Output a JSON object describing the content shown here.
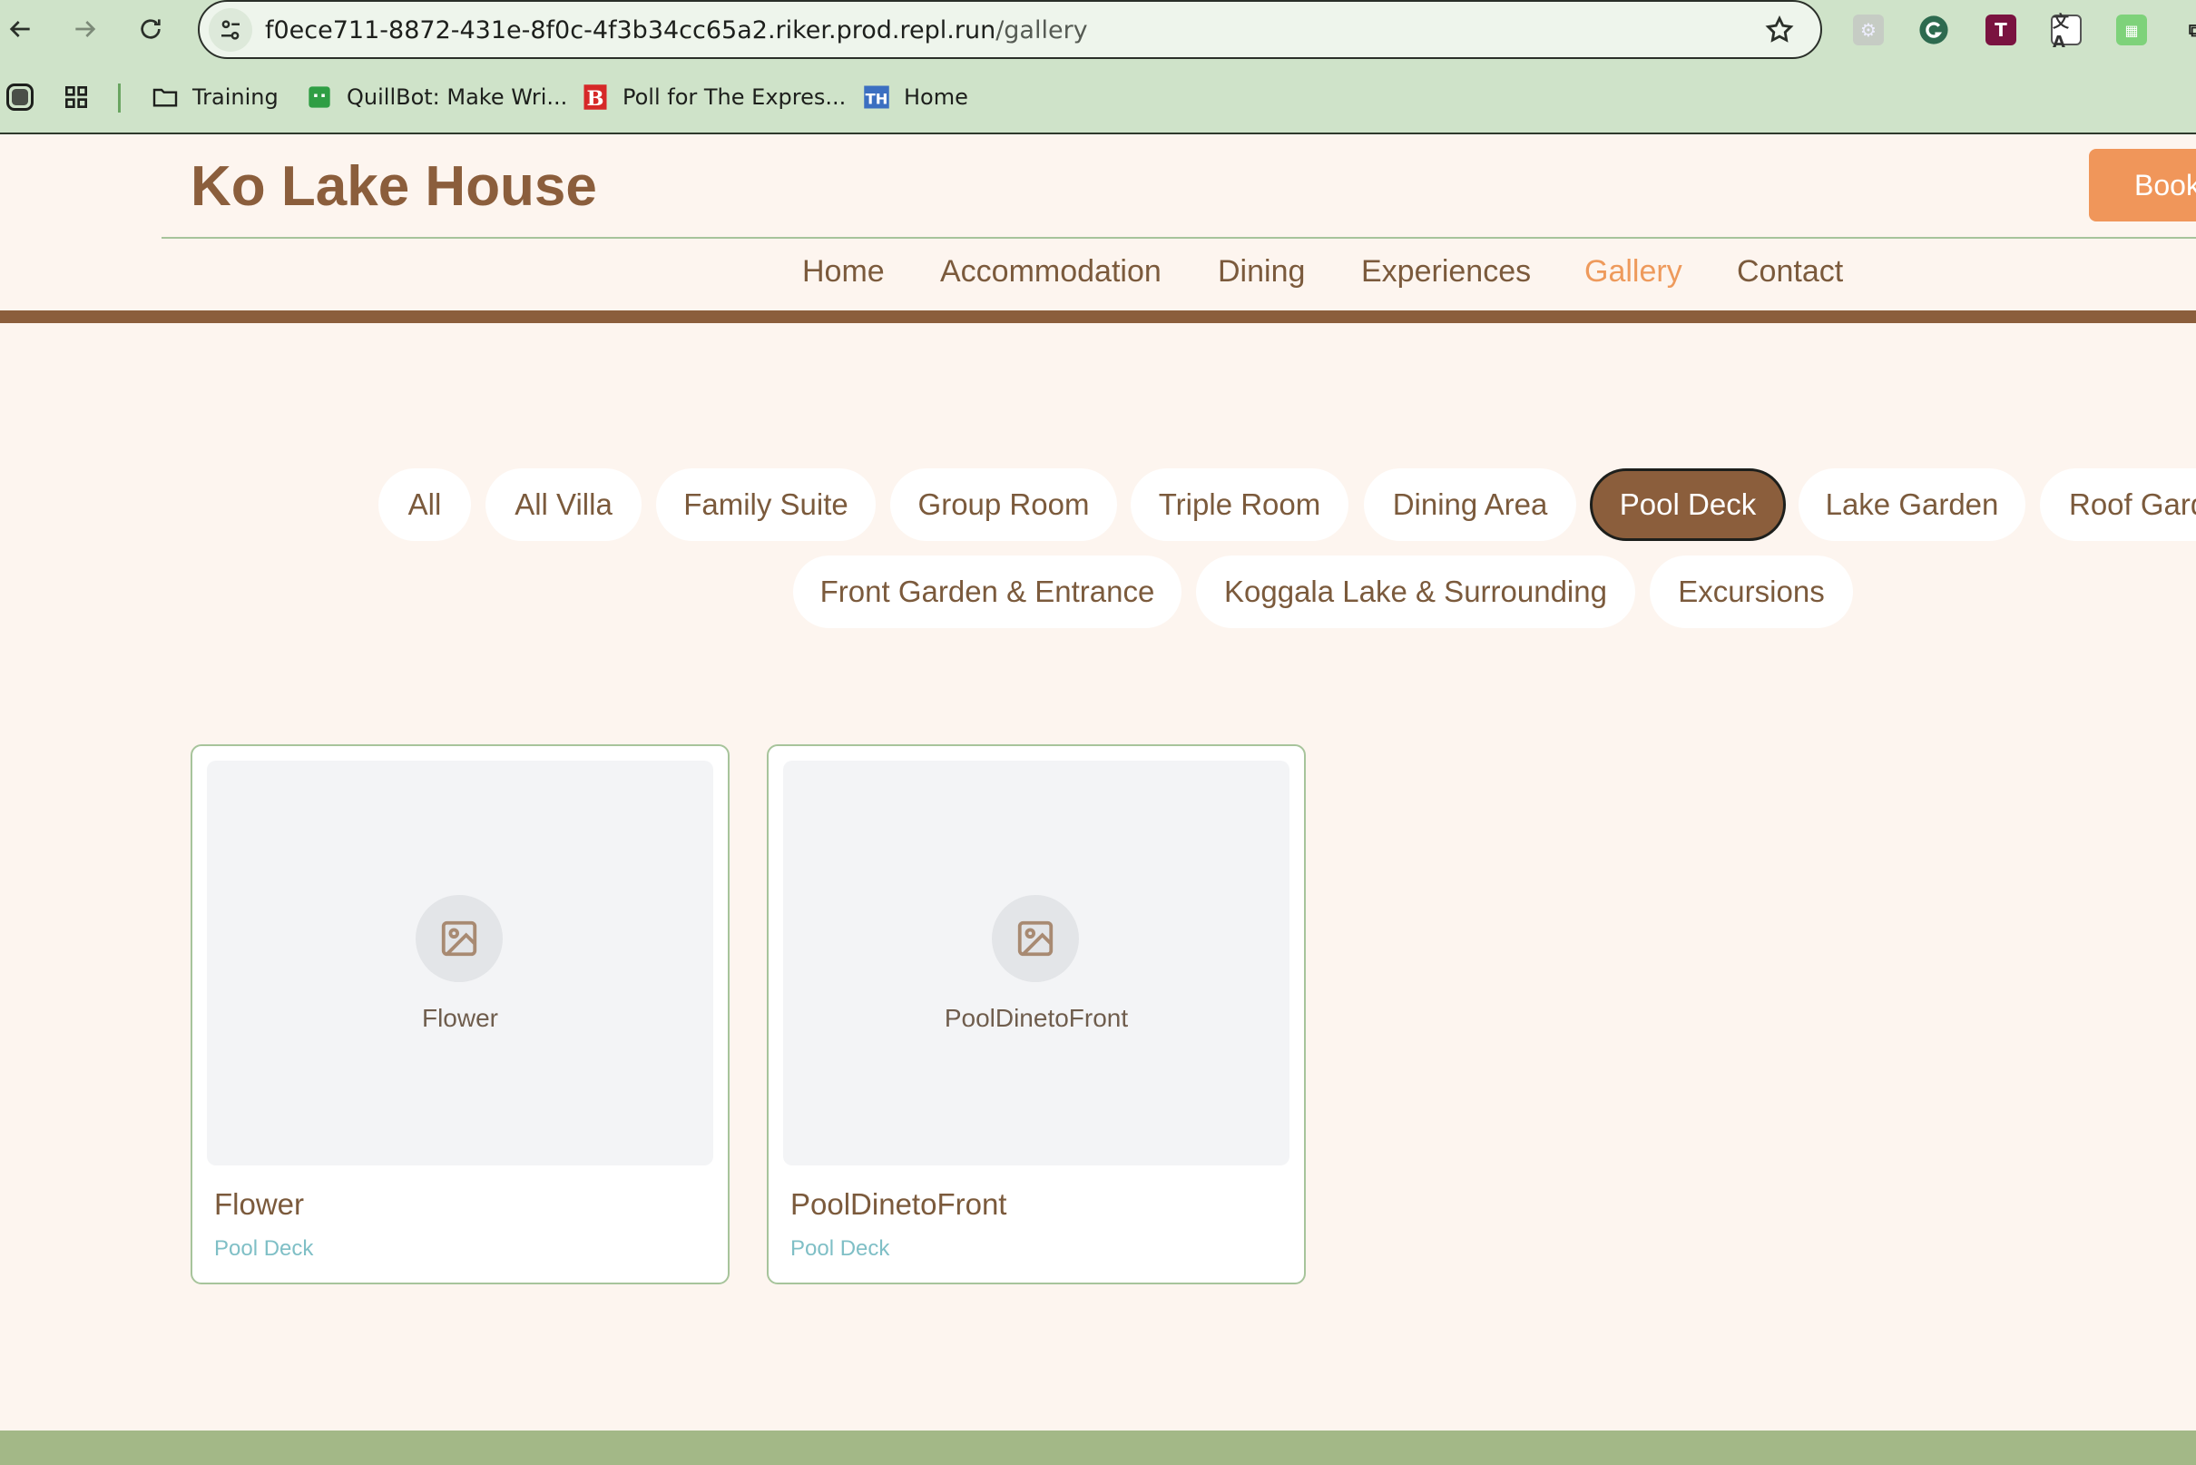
{
  "browser": {
    "url_host": "f0ece711-8872-431e-8f0c-4f3b34cc65a2.riker.prod.repl.run",
    "url_path": "/gallery",
    "bookmarks": [
      {
        "label": "Training",
        "icon": "folder-icon"
      },
      {
        "label": "QuillBot: Make Wri...",
        "icon": "quillbot-icon"
      },
      {
        "label": "Poll for The Expres...",
        "icon": "poll-b-icon"
      },
      {
        "label": "Home",
        "icon": "th-icon"
      }
    ],
    "extensions": [
      "puzzle-gray-icon",
      "grammarly-icon",
      "t-icon",
      "translate-icon",
      "green-ext-icon"
    ]
  },
  "site": {
    "brand": "Ko Lake House",
    "book_button": "Book",
    "nav": [
      {
        "label": "Home",
        "active": false
      },
      {
        "label": "Accommodation",
        "active": false
      },
      {
        "label": "Dining",
        "active": false
      },
      {
        "label": "Experiences",
        "active": false
      },
      {
        "label": "Gallery",
        "active": true
      },
      {
        "label": "Contact",
        "active": false
      }
    ],
    "accent_color": "#8b5e3c",
    "active_nav_color": "#ee9a5c"
  },
  "filters": [
    {
      "label": "All",
      "active": false
    },
    {
      "label": "All Villa",
      "active": false
    },
    {
      "label": "Family Suite",
      "active": false
    },
    {
      "label": "Group Room",
      "active": false
    },
    {
      "label": "Triple Room",
      "active": false
    },
    {
      "label": "Dining Area",
      "active": false
    },
    {
      "label": "Pool Deck",
      "active": true
    },
    {
      "label": "Lake Garden",
      "active": false
    },
    {
      "label": "Roof Garden",
      "active": false
    },
    {
      "label": "Front Garden & Entrance",
      "active": false
    },
    {
      "label": "Koggala Lake & Surrounding",
      "active": false
    },
    {
      "label": "Excursions",
      "active": false
    }
  ],
  "gallery": [
    {
      "placeholder_label": "Flower",
      "title": "Flower",
      "category": "Pool Deck"
    },
    {
      "placeholder_label": "PoolDinetoFront",
      "title": "PoolDinetoFront",
      "category": "Pool Deck"
    }
  ]
}
